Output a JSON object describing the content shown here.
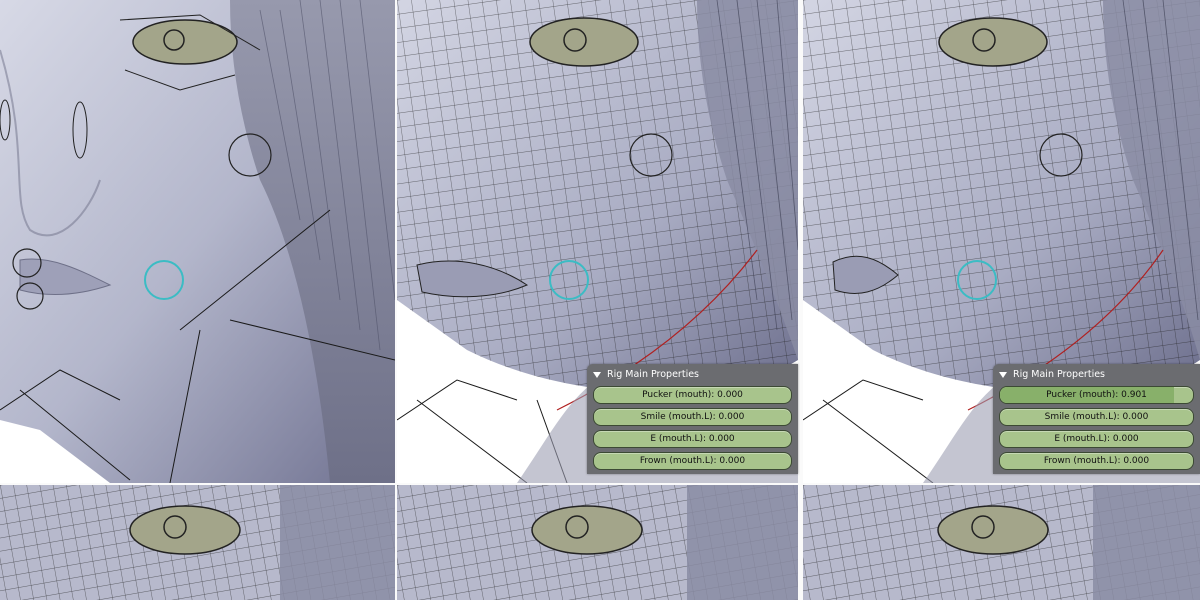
{
  "panels": [
    {
      "title": "Rig Main Properties",
      "sliders": [
        {
          "label": "Pucker (mouth): 0.000",
          "value": 0.0
        },
        {
          "label": "Smile (mouth.L): 0.000",
          "value": 0.0
        },
        {
          "label": "E (mouth.L): 0.000",
          "value": 0.0
        },
        {
          "label": "Frown (mouth.L): 0.000",
          "value": 0.0
        }
      ]
    },
    {
      "title": "Rig Main Properties",
      "sliders": [
        {
          "label": "Pucker (mouth): 0.901",
          "value": 0.901
        },
        {
          "label": "Smile (mouth.L): 0.000",
          "value": 0.0
        },
        {
          "label": "E (mouth.L): 0.000",
          "value": 0.0
        },
        {
          "label": "Frown (mouth.L): 0.000",
          "value": 0.0
        }
      ]
    }
  ],
  "colors": {
    "skin": "#b9bcd0",
    "skin_dark": "#7d7f99",
    "hair": "#8a8ca3",
    "wire": "#1a1a1a",
    "control_circle": "#3bbcc4",
    "bone_line": "#b02020",
    "slider_green": "#a8c48c",
    "panel_bg": "#6b6c70"
  }
}
